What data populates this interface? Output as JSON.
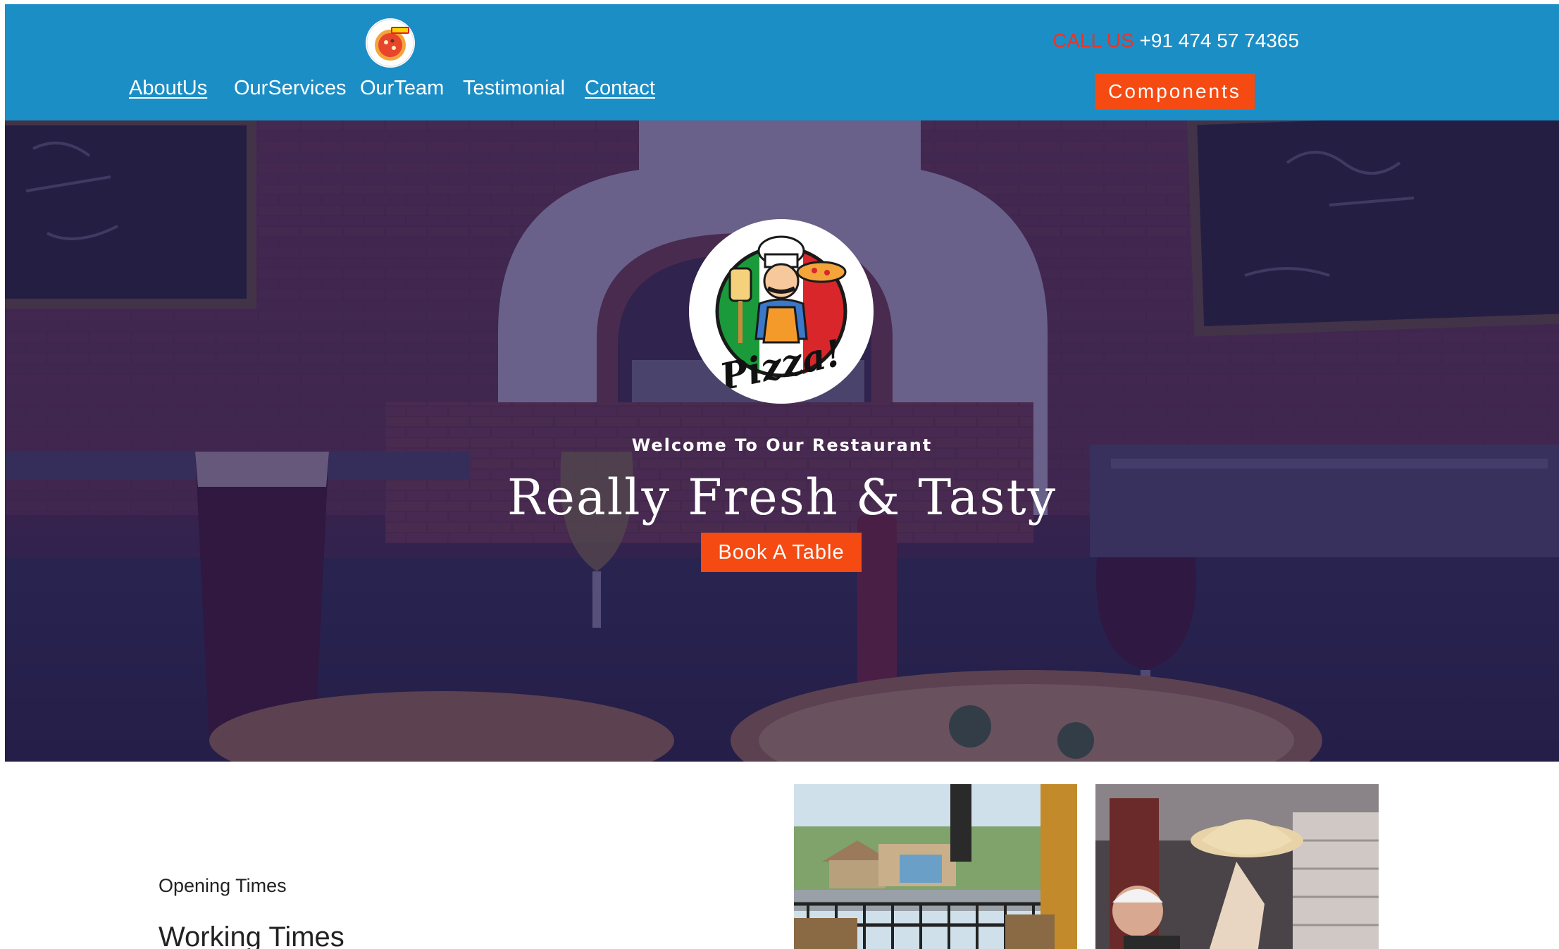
{
  "header": {
    "nav": [
      {
        "label": "AboutUs"
      },
      {
        "label": "OurServices"
      },
      {
        "label": "OurTeam"
      },
      {
        "label": "Testimonial"
      },
      {
        "label": "Contact"
      }
    ],
    "call_label": "CALL US",
    "call_number": "+91 474 57 74365",
    "components_label": "Components",
    "logo_icon": "pizza-logo-icon",
    "brand_color": "#1b8ec6",
    "accent_color": "#f54a12"
  },
  "hero": {
    "logo_text": "Pizza!",
    "welcome": "Welcome To Our Restaurant",
    "headline": "Really Fresh & Tasty",
    "book_label": "Book A Table",
    "overlay_color": "#2a2056"
  },
  "hours": {
    "eyebrow": "Opening Times",
    "title": "Working Times"
  }
}
